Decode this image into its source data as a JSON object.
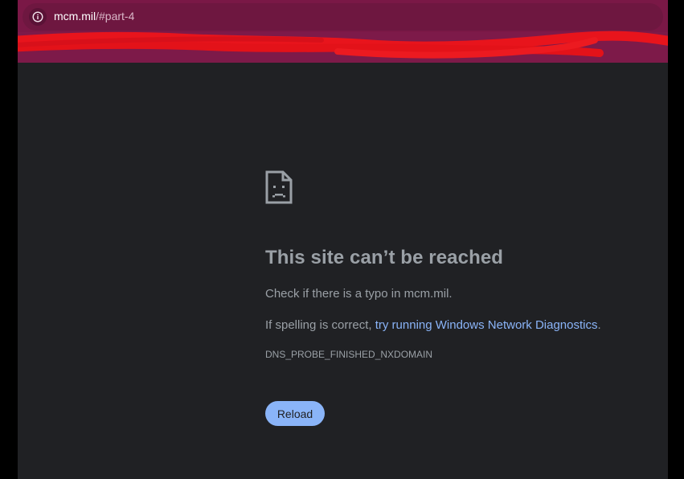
{
  "address_bar": {
    "host": "mcm.mil",
    "path": "/#part-4"
  },
  "error": {
    "title": "This site can’t be reached",
    "typo_hint": "Check if there is a typo in mcm.mil.",
    "spelling_prefix": "If spelling is correct, ",
    "diagnostics_link": "try running Windows Network Diagnostics",
    "spelling_suffix": ".",
    "error_code": "DNS_PROBE_FINISHED_NXDOMAIN",
    "reload_label": "Reload"
  },
  "colors": {
    "toolbar": "#7a1846",
    "page_background": "#202124",
    "link": "#8ab4f8",
    "button": "#8ab4f8",
    "redaction": "#e8141c"
  },
  "icons": {
    "site_info": "info-icon",
    "error_graphic": "sad-document-icon"
  }
}
